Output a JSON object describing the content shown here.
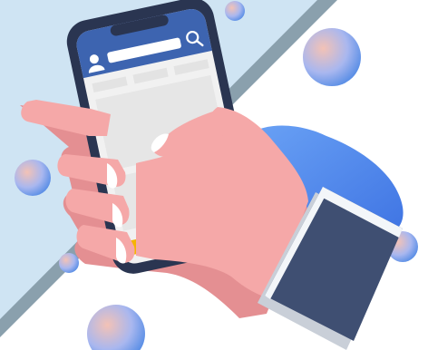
{
  "scene": {
    "description_free": true,
    "colors": {
      "background_light_blue": "#cfe4f3",
      "background_white": "#ffffff",
      "stripe_gray": "#8aa0ad",
      "bubble_blue": "#5b8fe6",
      "bubble_peach": "#f3c2b6",
      "hand_skin": "#f5a8a8",
      "hand_shadow": "#e48f92",
      "blue_cuff": "#4f86ee",
      "sleeve_dark": "#3f4f72",
      "phone_body": "#2a3551",
      "phone_header": "#3d64b0",
      "screen_bg": "#f1f1f1",
      "card_gray": "#e3e3e3",
      "nail_white": "#ffffff"
    },
    "icons": [
      "search-icon",
      "avatar-icon"
    ],
    "app_icons": [
      {
        "name": "app-icon-yellow",
        "color": "#f5b400"
      },
      {
        "name": "app-icon-pink",
        "color": "#ef5a7a"
      },
      {
        "name": "app-icon-green",
        "color": "#20c36a"
      },
      {
        "name": "app-icon-purple",
        "color": "#6d5cf2"
      }
    ]
  }
}
